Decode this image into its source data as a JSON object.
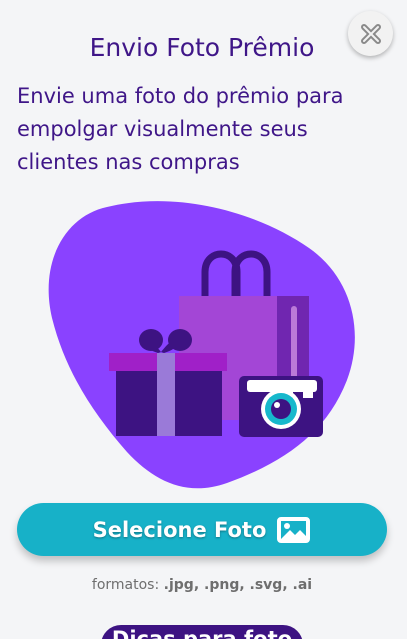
{
  "modal": {
    "title": "Envio Foto Prêmio",
    "description": "Envie uma foto do prêmio para empolgar visualmente seus clientes nas compras"
  },
  "close_icon": "close-icon",
  "illustration_icons": [
    "shopping-bag-icon",
    "gift-box-icon",
    "camera-icon"
  ],
  "select_button": {
    "label": "Selecione Foto",
    "icon": "image-icon"
  },
  "formats": {
    "prefix": "formatos:",
    "list": ".jpg, .png, .svg, .ai"
  },
  "tips_button": {
    "label": "Dicas para foto"
  },
  "colors": {
    "title": "#3f1688",
    "blob": "#8a42ff",
    "primary_button": "#17b1c8",
    "secondary_button": "#3d1382",
    "background": "#f4f5f7"
  }
}
